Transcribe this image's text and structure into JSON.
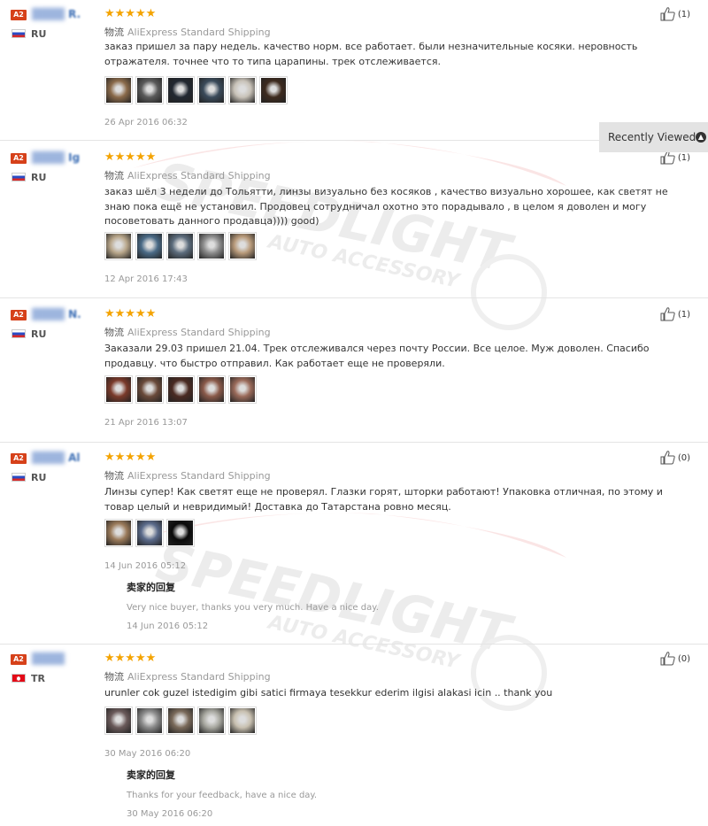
{
  "recently_viewed": {
    "label": "Recently Viewed",
    "icon": "chevron-up-icon"
  },
  "watermark": {
    "line1": "SPEEDLIGHT",
    "line2": "AUTO ACCESSORY"
  },
  "reviews": [
    {
      "badge": "A2",
      "name_visible": "R.",
      "country": "RU",
      "flag": "ru",
      "shipping_cn": "物流",
      "shipping": "AliExpress Standard Shipping",
      "text": "заказ пришел за пару недель. качество норм. все работает. были незначительные косяки. неровность отражателя. точнее что то типа царапины. трек отслеживается.",
      "photos": [
        "#8a6a4a",
        "#5a5a5a",
        "#222831",
        "#3a4a5a",
        "#c8c2b8",
        "#3d2a1e"
      ],
      "date": "26 Apr 2016 06:32",
      "likes": "(1)"
    },
    {
      "badge": "A2",
      "name_visible": "Ig",
      "country": "RU",
      "flag": "ru",
      "shipping_cn": "物流",
      "shipping": "AliExpress Standard Shipping",
      "text": "заказ шёл 3 недели до Тольятти, линзы визуально без косяков , качество визуально хорошее, как светят не знаю пока ещё не установил. Продовец сотрудничал охотно это порадывало , в целом я доволен и могу посоветовать данного продавца)))) good)",
      "photos": [
        "#b8a68a",
        "#4a6a86",
        "#5c6c7c",
        "#8c8c8c",
        "#b89a7a"
      ],
      "date": "12 Apr 2016 17:43",
      "likes": "(1)"
    },
    {
      "badge": "A2",
      "name_visible": "N.",
      "country": "RU",
      "flag": "ru",
      "shipping_cn": "物流",
      "shipping": "AliExpress Standard Shipping",
      "text": "Заказали 29.03 пришел 21.04. Трек отслеживался через почту России. Все целое. Муж доволен. Спасибо продавцу. что быстро отправил. Как работает еще не проверяли.",
      "photos": [
        "#7a3a2a",
        "#6a4a3a",
        "#4a2a22",
        "#8a5a4a",
        "#9a6a5a"
      ],
      "date": "21 Apr 2016 13:07",
      "likes": "(1)"
    },
    {
      "badge": "A2",
      "name_visible": "Al",
      "country": "RU",
      "flag": "ru",
      "shipping_cn": "物流",
      "shipping": "AliExpress Standard Shipping",
      "text": "Линзы супер! Как светят еще не проверял. Глазки горят, шторки работают! Упаковка отличная, по этому и товар целый и невридимый! Доставка до Татарстана ровно месяц.",
      "photos": [
        "#9a7a5a",
        "#5a6a8a",
        "#0a0a0a"
      ],
      "date": "14 Jun 2016 05:12",
      "likes": "(0)",
      "reply": {
        "title": "卖家的回复",
        "message": "Very nice buyer, thanks you very much. Have a nice day.",
        "date": "14 Jun 2016 05:12"
      }
    },
    {
      "badge": "A2",
      "name_visible": "",
      "country": "TR",
      "flag": "tr",
      "shipping_cn": "物流",
      "shipping": "AliExpress Standard Shipping",
      "text": "urunler cok guzel istedigim gibi satici firmaya tesekkur ederim ilgisi alakasi icin .. thank you",
      "photos": [
        "#6a5a5a",
        "#8a8a8a",
        "#7a6a5a",
        "#a8a8a0",
        "#c8c0b0"
      ],
      "date": "30 May 2016 06:20",
      "likes": "(0)",
      "reply": {
        "title": "卖家的回复",
        "message": "Thanks for your feedback, have a nice day.",
        "date": "30 May 2016 06:20"
      }
    }
  ]
}
